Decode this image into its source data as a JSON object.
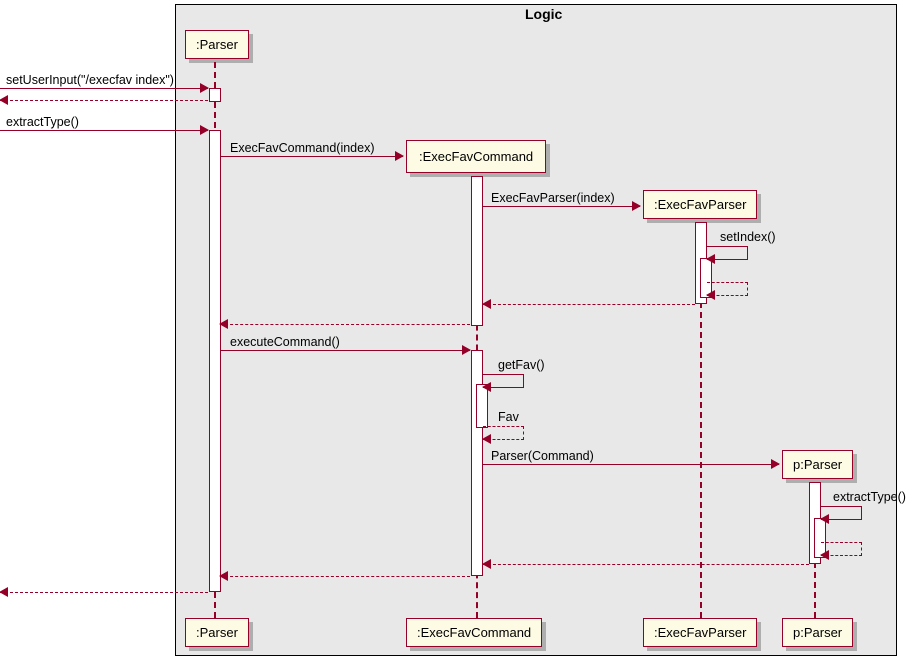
{
  "frame": {
    "name": "Logic"
  },
  "participants": {
    "parser": ":Parser",
    "execFavCommand": ":ExecFavCommand",
    "execFavParser": ":ExecFavParser",
    "pParser": "p:Parser"
  },
  "messages": {
    "setUserInput": "setUserInput(\"/execfav index\")",
    "extractType1": "extractType()",
    "execFavCommandCreate": "ExecFavCommand(index)",
    "execFavParserCreate": "ExecFavParser(index)",
    "setIndex": "setIndex()",
    "executeCommand": "executeCommand()",
    "getFav": "getFav()",
    "favReturn": "Fav",
    "parserCommand": "Parser(Command)",
    "extractType2": "extractType()"
  }
}
